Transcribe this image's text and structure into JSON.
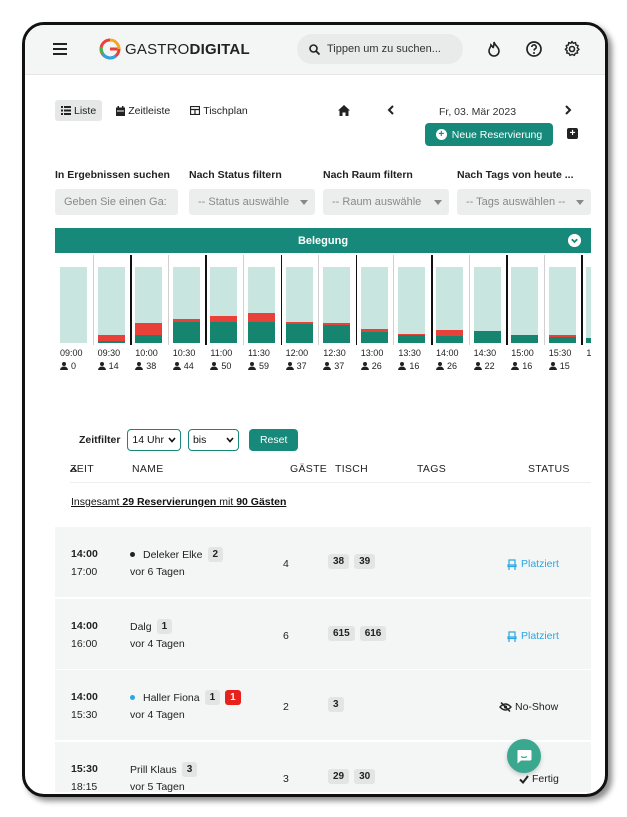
{
  "topbar": {
    "brand_light": "GASTRO",
    "brand_bold": "DIGITAL",
    "search_placeholder": "Tippen um zu suchen...",
    "icons": [
      "menu-icon",
      "flame-icon",
      "help-icon",
      "gear-icon"
    ]
  },
  "toolbar": {
    "views": [
      "Liste",
      "Zeitleiste",
      "Tischplan"
    ],
    "active_view": "Liste",
    "date": "Fr, 03. Mär 2023",
    "new_reservation": "Neue Reservierung"
  },
  "filters": {
    "search_label": "In Ergebnissen suchen",
    "search_placeholder": "Geben Sie einen Ga:",
    "status_label": "Nach Status filtern",
    "status_placeholder": "-- Status auswähle",
    "room_label": "Nach Raum filtern",
    "room_placeholder": "-- Raum auswähle",
    "tags_label": "Nach Tags von heute ...",
    "tags_placeholder": "-- Tags auswählen --"
  },
  "occupancy": {
    "title": "Belegung",
    "slots": [
      {
        "time": "09:00",
        "guests": "0",
        "green": 0.0,
        "red": 0.0
      },
      {
        "time": "09:30",
        "guests": "14",
        "green": 0.03,
        "red": 0.08
      },
      {
        "time": "10:00",
        "guests": "38",
        "green": 0.1,
        "red": 0.17
      },
      {
        "time": "10:30",
        "guests": "44",
        "green": 0.27,
        "red": 0.04
      },
      {
        "time": "11:00",
        "guests": "50",
        "green": 0.28,
        "red": 0.07
      },
      {
        "time": "11:30",
        "guests": "59",
        "green": 0.28,
        "red": 0.12
      },
      {
        "time": "12:00",
        "guests": "37",
        "green": 0.25,
        "red": 0.02
      },
      {
        "time": "12:30",
        "guests": "37",
        "green": 0.24,
        "red": 0.03
      },
      {
        "time": "13:00",
        "guests": "26",
        "green": 0.15,
        "red": 0.04
      },
      {
        "time": "13:30",
        "guests": "16",
        "green": 0.1,
        "red": 0.02
      },
      {
        "time": "14:00",
        "guests": "26",
        "green": 0.09,
        "red": 0.08
      },
      {
        "time": "14:30",
        "guests": "22",
        "green": 0.16,
        "red": 0.0
      },
      {
        "time": "15:00",
        "guests": "16",
        "green": 0.11,
        "red": 0.0
      },
      {
        "time": "15:30",
        "guests": "15",
        "green": 0.08,
        "red": 0.03
      },
      {
        "time": "1",
        "guests": "",
        "green": 0.06,
        "red": 0.0
      }
    ]
  },
  "timefilter": {
    "label": "Zeitfilter",
    "from": "14 Uhr",
    "to": "bis",
    "reset": "Reset"
  },
  "table": {
    "headers": {
      "time": "ZEIT",
      "name": "NAME",
      "guests": "GÄSTE",
      "table": "TISCH",
      "tags": "TAGS",
      "status": "STATUS"
    },
    "summary_prefix": "Insgesamt",
    "summary_count": "29 Reservierungen",
    "summary_mid": "mit",
    "summary_guests": "90 Gästen",
    "rows": [
      {
        "start": "14:00",
        "end": "17:00",
        "name": "Deleker Elke",
        "visits": "2",
        "alert": "",
        "ago": "vor 6 Tagen",
        "guests": "4",
        "tables": [
          "38",
          "39"
        ],
        "status": "Platziert",
        "dot": "#222222"
      },
      {
        "start": "14:00",
        "end": "16:00",
        "name": "Dalg",
        "visits": "1",
        "alert": "",
        "ago": "vor 4 Tagen",
        "guests": "6",
        "tables": [
          "615",
          "616"
        ],
        "status": "Platziert",
        "dot": ""
      },
      {
        "start": "14:00",
        "end": "15:30",
        "name": "Haller Fiona",
        "visits": "1",
        "alert": "1",
        "ago": "vor 4 Tagen",
        "guests": "2",
        "tables": [
          "3"
        ],
        "status": "No-Show",
        "dot": "#2aa7e0"
      },
      {
        "start": "15:30",
        "end": "18:15",
        "name": "Prill Klaus",
        "visits": "3",
        "alert": "",
        "ago": "vor 5 Tagen",
        "guests": "3",
        "tables": [
          "29",
          "30"
        ],
        "status": "Fertig",
        "dot": ""
      }
    ]
  },
  "colors": {
    "accent": "#17897a",
    "occupied": "#16856f",
    "overbooked": "#e8413a",
    "capacity": "#c8e6df",
    "placed": "#2aa7e0"
  }
}
